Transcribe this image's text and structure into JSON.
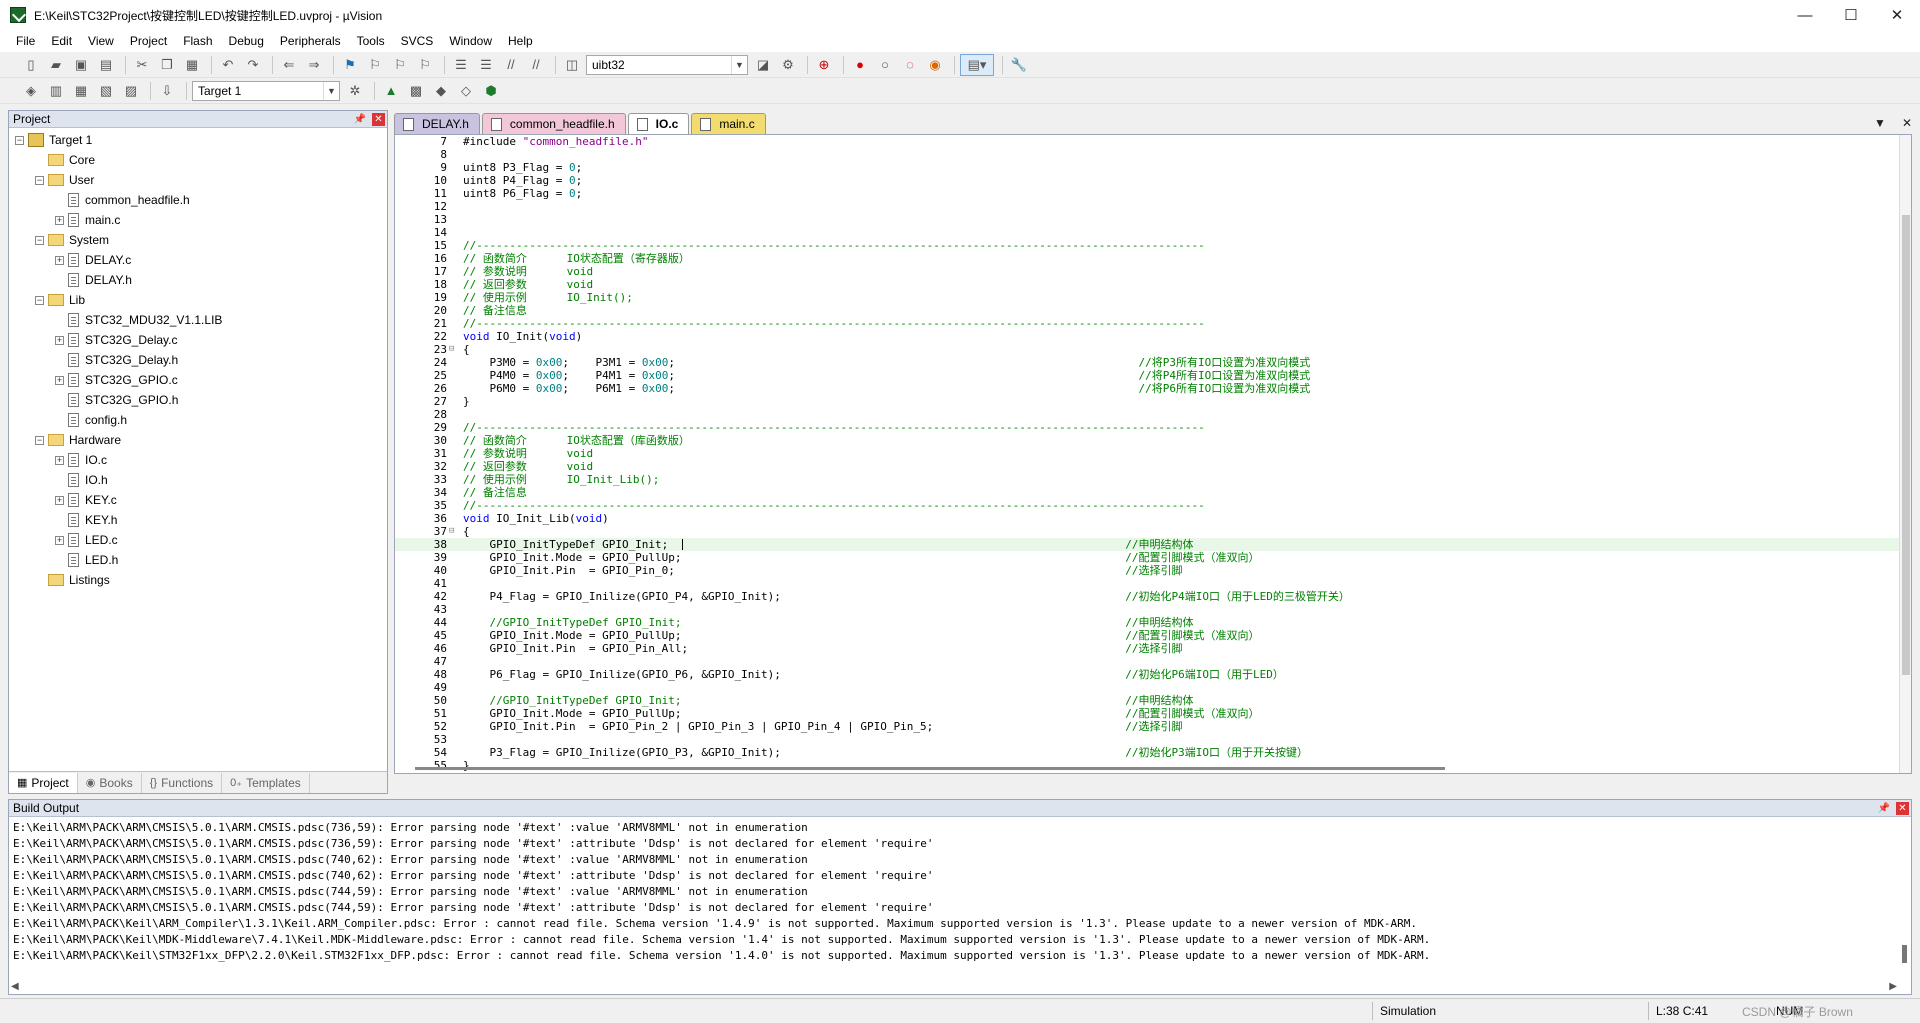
{
  "window": {
    "title": "E:\\Keil\\STC32Project\\按键控制LED\\按键控制LED.uvproj - µVision",
    "controls": [
      "—",
      "☐",
      "✕"
    ]
  },
  "menubar": {
    "items": [
      "File",
      "Edit",
      "View",
      "Project",
      "Flash",
      "Debug",
      "Peripherals",
      "Tools",
      "SVCS",
      "Window",
      "Help"
    ]
  },
  "toolbar": {
    "search_value": "uibt32",
    "target_value": "Target 1"
  },
  "project_panel": {
    "title": "Project",
    "tree": [
      {
        "label": "Target 1",
        "level": 0,
        "kind": "target",
        "expander": "⊟"
      },
      {
        "label": "Core",
        "level": 1,
        "kind": "folder",
        "expander": ""
      },
      {
        "label": "User",
        "level": 1,
        "kind": "folder",
        "expander": "⊟"
      },
      {
        "label": "common_headfile.h",
        "level": 2,
        "kind": "file",
        "expander": ""
      },
      {
        "label": "main.c",
        "level": 2,
        "kind": "file",
        "expander": "⊞"
      },
      {
        "label": "System",
        "level": 1,
        "kind": "folder",
        "expander": "⊟"
      },
      {
        "label": "DELAY.c",
        "level": 2,
        "kind": "file",
        "expander": "⊞"
      },
      {
        "label": "DELAY.h",
        "level": 2,
        "kind": "file",
        "expander": ""
      },
      {
        "label": "Lib",
        "level": 1,
        "kind": "folder",
        "expander": "⊟"
      },
      {
        "label": "STC32_MDU32_V1.1.LIB",
        "level": 2,
        "kind": "file",
        "expander": ""
      },
      {
        "label": "STC32G_Delay.c",
        "level": 2,
        "kind": "file",
        "expander": "⊞"
      },
      {
        "label": "STC32G_Delay.h",
        "level": 2,
        "kind": "file",
        "expander": ""
      },
      {
        "label": "STC32G_GPIO.c",
        "level": 2,
        "kind": "file",
        "expander": "⊞"
      },
      {
        "label": "STC32G_GPIO.h",
        "level": 2,
        "kind": "file",
        "expander": ""
      },
      {
        "label": "config.h",
        "level": 2,
        "kind": "file",
        "expander": ""
      },
      {
        "label": "Hardware",
        "level": 1,
        "kind": "folder",
        "expander": "⊟"
      },
      {
        "label": "IO.c",
        "level": 2,
        "kind": "file",
        "expander": "⊞"
      },
      {
        "label": "IO.h",
        "level": 2,
        "kind": "file",
        "expander": ""
      },
      {
        "label": "KEY.c",
        "level": 2,
        "kind": "file",
        "expander": "⊞"
      },
      {
        "label": "KEY.h",
        "level": 2,
        "kind": "file",
        "expander": ""
      },
      {
        "label": "LED.c",
        "level": 2,
        "kind": "file",
        "expander": "⊞"
      },
      {
        "label": "LED.h",
        "level": 2,
        "kind": "file",
        "expander": ""
      },
      {
        "label": "Listings",
        "level": 1,
        "kind": "folder",
        "expander": ""
      }
    ],
    "bottom_tabs": [
      {
        "label": "Project",
        "icon": "▦",
        "active": true
      },
      {
        "label": "Books",
        "icon": "◉",
        "active": false
      },
      {
        "label": "Functions",
        "icon": "{}",
        "active": false
      },
      {
        "label": "Templates",
        "icon": "0₊",
        "active": false
      }
    ]
  },
  "editor": {
    "tabs": [
      {
        "label": "DELAY.h",
        "color": "purple",
        "active": false
      },
      {
        "label": "common_headfile.h",
        "color": "pink",
        "active": false
      },
      {
        "label": "IO.c",
        "color": "green",
        "active": true
      },
      {
        "label": "main.c",
        "color": "yellow",
        "active": false
      }
    ],
    "lines": [
      {
        "n": "7",
        "fold": "",
        "parts": [
          [
            "#include ",
            ""
          ],
          [
            "\"common_headfile.h\"",
            "str"
          ]
        ]
      },
      {
        "n": "8",
        "fold": "",
        "parts": []
      },
      {
        "n": "9",
        "fold": "",
        "parts": [
          [
            "uint8 P3_Flag = ",
            ""
          ],
          [
            "0",
            "num"
          ],
          [
            ";",
            ""
          ]
        ]
      },
      {
        "n": "10",
        "fold": "",
        "parts": [
          [
            "uint8 P4_Flag = ",
            ""
          ],
          [
            "0",
            "num"
          ],
          [
            ";",
            ""
          ]
        ]
      },
      {
        "n": "11",
        "fold": "",
        "parts": [
          [
            "uint8 P6_Flag = ",
            ""
          ],
          [
            "0",
            "num"
          ],
          [
            ";",
            ""
          ]
        ]
      },
      {
        "n": "12",
        "fold": "",
        "parts": []
      },
      {
        "n": "13",
        "fold": "",
        "parts": []
      },
      {
        "n": "14",
        "fold": "",
        "parts": []
      },
      {
        "n": "15",
        "fold": "",
        "parts": [
          [
            "//--------------------------------------------------------------------------------------------------------------",
            "cmt"
          ]
        ]
      },
      {
        "n": "16",
        "fold": "",
        "parts": [
          [
            "// 函数简介      IO状态配置（寄存器版）",
            "cmt"
          ]
        ]
      },
      {
        "n": "17",
        "fold": "",
        "parts": [
          [
            "// 参数说明      void",
            "cmt"
          ]
        ]
      },
      {
        "n": "18",
        "fold": "",
        "parts": [
          [
            "// 返回参数      void",
            "cmt"
          ]
        ]
      },
      {
        "n": "19",
        "fold": "",
        "parts": [
          [
            "// 使用示例      IO_Init();",
            "cmt"
          ]
        ]
      },
      {
        "n": "20",
        "fold": "",
        "parts": [
          [
            "// 备注信息",
            "cmt"
          ]
        ]
      },
      {
        "n": "21",
        "fold": "",
        "parts": [
          [
            "//--------------------------------------------------------------------------------------------------------------",
            "cmt"
          ]
        ]
      },
      {
        "n": "22",
        "fold": "",
        "parts": [
          [
            "void",
            "kw"
          ],
          [
            " IO_Init(",
            ""
          ],
          [
            "void",
            "kw"
          ],
          [
            ")",
            ""
          ]
        ]
      },
      {
        "n": "23",
        "fold": "⊟",
        "parts": [
          [
            "{",
            ""
          ]
        ]
      },
      {
        "n": "24",
        "fold": "",
        "parts": [
          [
            "    P3M0 = ",
            ""
          ],
          [
            "0x00",
            "num"
          ],
          [
            ";    P3M1 = ",
            ""
          ],
          [
            "0x00",
            "num"
          ],
          [
            ";                                                                      ",
            ""
          ],
          [
            "//将P3所有IO口设置为准双向模式",
            "cmt"
          ]
        ]
      },
      {
        "n": "25",
        "fold": "",
        "parts": [
          [
            "    P4M0 = ",
            ""
          ],
          [
            "0x00",
            "num"
          ],
          [
            ";    P4M1 = ",
            ""
          ],
          [
            "0x00",
            "num"
          ],
          [
            ";                                                                      ",
            ""
          ],
          [
            "//将P4所有IO口设置为准双向模式",
            "cmt"
          ]
        ]
      },
      {
        "n": "26",
        "fold": "",
        "parts": [
          [
            "    P6M0 = ",
            ""
          ],
          [
            "0x00",
            "num"
          ],
          [
            ";    P6M1 = ",
            ""
          ],
          [
            "0x00",
            "num"
          ],
          [
            ";                                                                      ",
            ""
          ],
          [
            "//将P6所有IO口设置为准双向模式",
            "cmt"
          ]
        ]
      },
      {
        "n": "27",
        "fold": "",
        "parts": [
          [
            "}",
            ""
          ]
        ]
      },
      {
        "n": "28",
        "fold": "",
        "parts": []
      },
      {
        "n": "29",
        "fold": "",
        "parts": [
          [
            "//--------------------------------------------------------------------------------------------------------------",
            "cmt"
          ]
        ]
      },
      {
        "n": "30",
        "fold": "",
        "parts": [
          [
            "// 函数简介      IO状态配置（库函数版）",
            "cmt"
          ]
        ]
      },
      {
        "n": "31",
        "fold": "",
        "parts": [
          [
            "// 参数说明      void",
            "cmt"
          ]
        ]
      },
      {
        "n": "32",
        "fold": "",
        "parts": [
          [
            "// 返回参数      void",
            "cmt"
          ]
        ]
      },
      {
        "n": "33",
        "fold": "",
        "parts": [
          [
            "// 使用示例      IO_Init_Lib();",
            "cmt"
          ]
        ]
      },
      {
        "n": "34",
        "fold": "",
        "parts": [
          [
            "// 备注信息",
            "cmt"
          ]
        ]
      },
      {
        "n": "35",
        "fold": "",
        "parts": [
          [
            "//--------------------------------------------------------------------------------------------------------------",
            "cmt"
          ]
        ]
      },
      {
        "n": "36",
        "fold": "",
        "parts": [
          [
            "void",
            "kw"
          ],
          [
            " IO_Init_Lib(",
            ""
          ],
          [
            "void",
            "kw"
          ],
          [
            ")",
            ""
          ]
        ]
      },
      {
        "n": "37",
        "fold": "⊟",
        "parts": [
          [
            "{",
            ""
          ]
        ]
      },
      {
        "n": "38",
        "fold": "",
        "cur": true,
        "parts": [
          [
            "    GPIO_InitTypeDef GPIO_Init;                                                                     ",
            ""
          ],
          [
            "//申明结构体",
            "cmt"
          ]
        ]
      },
      {
        "n": "39",
        "fold": "",
        "parts": [
          [
            "    GPIO_Init.Mode = GPIO_PullUp;                                                                   ",
            ""
          ],
          [
            "//配置引脚模式（准双向）",
            "cmt"
          ]
        ]
      },
      {
        "n": "40",
        "fold": "",
        "parts": [
          [
            "    GPIO_Init.Pin  = GPIO_Pin_0;                                                                    ",
            ""
          ],
          [
            "//选择引脚",
            "cmt"
          ]
        ]
      },
      {
        "n": "41",
        "fold": "",
        "parts": []
      },
      {
        "n": "42",
        "fold": "",
        "parts": [
          [
            "    P4_Flag = GPIO_Inilize(GPIO_P4, &GPIO_Init);                                                    ",
            ""
          ],
          [
            "//初始化P4端IO口（用于LED的三极管开关）",
            "cmt"
          ]
        ]
      },
      {
        "n": "43",
        "fold": "",
        "parts": []
      },
      {
        "n": "44",
        "fold": "",
        "parts": [
          [
            "    ",
            ""
          ],
          [
            "//GPIO_InitTypeDef GPIO_Init;",
            "cmt"
          ],
          [
            "                                                                   ",
            ""
          ],
          [
            "//申明结构体",
            "cmt"
          ]
        ]
      },
      {
        "n": "45",
        "fold": "",
        "parts": [
          [
            "    GPIO_Init.Mode = GPIO_PullUp;                                                                   ",
            ""
          ],
          [
            "//配置引脚模式（准双向）",
            "cmt"
          ]
        ]
      },
      {
        "n": "46",
        "fold": "",
        "parts": [
          [
            "    GPIO_Init.Pin  = GPIO_Pin_All;                                                                  ",
            ""
          ],
          [
            "//选择引脚",
            "cmt"
          ]
        ]
      },
      {
        "n": "47",
        "fold": "",
        "parts": []
      },
      {
        "n": "48",
        "fold": "",
        "parts": [
          [
            "    P6_Flag = GPIO_Inilize(GPIO_P6, &GPIO_Init);                                                    ",
            ""
          ],
          [
            "//初始化P6端IO口（用于LED）",
            "cmt"
          ]
        ]
      },
      {
        "n": "49",
        "fold": "",
        "parts": []
      },
      {
        "n": "50",
        "fold": "",
        "parts": [
          [
            "    ",
            ""
          ],
          [
            "//GPIO_InitTypeDef GPIO_Init;",
            "cmt"
          ],
          [
            "                                                                   ",
            ""
          ],
          [
            "//申明结构体",
            "cmt"
          ]
        ]
      },
      {
        "n": "51",
        "fold": "",
        "parts": [
          [
            "    GPIO_Init.Mode = GPIO_PullUp;                                                                   ",
            ""
          ],
          [
            "//配置引脚模式（准双向）",
            "cmt"
          ]
        ]
      },
      {
        "n": "52",
        "fold": "",
        "parts": [
          [
            "    GPIO_Init.Pin  = GPIO_Pin_2 | GPIO_Pin_3 | GPIO_Pin_4 | GPIO_Pin_5;                             ",
            ""
          ],
          [
            "//选择引脚",
            "cmt"
          ]
        ]
      },
      {
        "n": "53",
        "fold": "",
        "parts": []
      },
      {
        "n": "54",
        "fold": "",
        "parts": [
          [
            "    P3_Flag = GPIO_Inilize(GPIO_P3, &GPIO_Init);                                                    ",
            ""
          ],
          [
            "//初始化P3端IO口（用于开关按键）",
            "cmt"
          ]
        ]
      },
      {
        "n": "55",
        "fold": "",
        "parts": [
          [
            "}",
            ""
          ]
        ]
      }
    ]
  },
  "build_output": {
    "title": "Build Output",
    "lines": [
      "E:\\Keil\\ARM\\PACK\\ARM\\CMSIS\\5.0.1\\ARM.CMSIS.pdsc(736,59): Error parsing node '#text' :value 'ARMV8MML' not in enumeration",
      "E:\\Keil\\ARM\\PACK\\ARM\\CMSIS\\5.0.1\\ARM.CMSIS.pdsc(736,59): Error parsing node '#text' :attribute 'Ddsp' is not declared for element 'require'",
      "E:\\Keil\\ARM\\PACK\\ARM\\CMSIS\\5.0.1\\ARM.CMSIS.pdsc(740,62): Error parsing node '#text' :value 'ARMV8MML' not in enumeration",
      "E:\\Keil\\ARM\\PACK\\ARM\\CMSIS\\5.0.1\\ARM.CMSIS.pdsc(740,62): Error parsing node '#text' :attribute 'Ddsp' is not declared for element 'require'",
      "E:\\Keil\\ARM\\PACK\\ARM\\CMSIS\\5.0.1\\ARM.CMSIS.pdsc(744,59): Error parsing node '#text' :value 'ARMV8MML' not in enumeration",
      "E:\\Keil\\ARM\\PACK\\ARM\\CMSIS\\5.0.1\\ARM.CMSIS.pdsc(744,59): Error parsing node '#text' :attribute 'Ddsp' is not declared for element 'require'",
      "E:\\Keil\\ARM\\PACK\\Keil\\ARM_Compiler\\1.3.1\\Keil.ARM_Compiler.pdsc: Error : cannot read file. Schema version '1.4.9' is not supported. Maximum supported version is '1.3'. Please update to a newer version of MDK-ARM.",
      "E:\\Keil\\ARM\\PACK\\Keil\\MDK-Middleware\\7.4.1\\Keil.MDK-Middleware.pdsc: Error : cannot read file. Schema version '1.4' is not supported. Maximum supported version is '1.3'. Please update to a newer version of MDK-ARM.",
      "E:\\Keil\\ARM\\PACK\\Keil\\STM32F1xx_DFP\\2.2.0\\Keil.STM32F1xx_DFP.pdsc: Error : cannot read file. Schema version '1.4.0' is not supported. Maximum supported version is '1.3'. Please update to a newer version of MDK-ARM."
    ]
  },
  "statusbar": {
    "mode": "Simulation",
    "position": "L:38 C:41",
    "num": "NUM",
    "watermark": "CSDN @橘子 Brown"
  }
}
